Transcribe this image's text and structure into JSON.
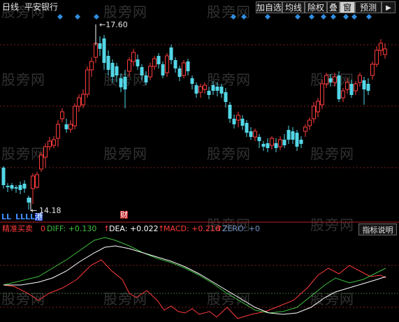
{
  "header": {
    "period": "日线",
    "stock_name": "平安银行",
    "buttons": [
      "加自选",
      "均线",
      "除权",
      "叠",
      "窗",
      "预测"
    ]
  },
  "main_chart": {
    "high_label": "←17.60",
    "low_label": "14.18",
    "markers": [
      "LL",
      "LLLL",
      "港"
    ],
    "finance_tag": "财",
    "watermark": "股旁网"
  },
  "indicator_bar": {
    "name": "精准买卖",
    "name_value": "0",
    "diff_label": "DIFF: +0.130",
    "dea_label": "DEA: +0.022",
    "macd_label": "MACD: +0.216",
    "zero_label": "ZERO: +0",
    "help_button": "指标说明"
  },
  "colors": {
    "up": "#ff3b3b",
    "down": "#53d7e7",
    "diff": "#3fbf3f",
    "dea": "#ffffff",
    "macd": "#ff3b3b",
    "grid": "#7a1e1e",
    "marker": "#2f8de0"
  }
}
